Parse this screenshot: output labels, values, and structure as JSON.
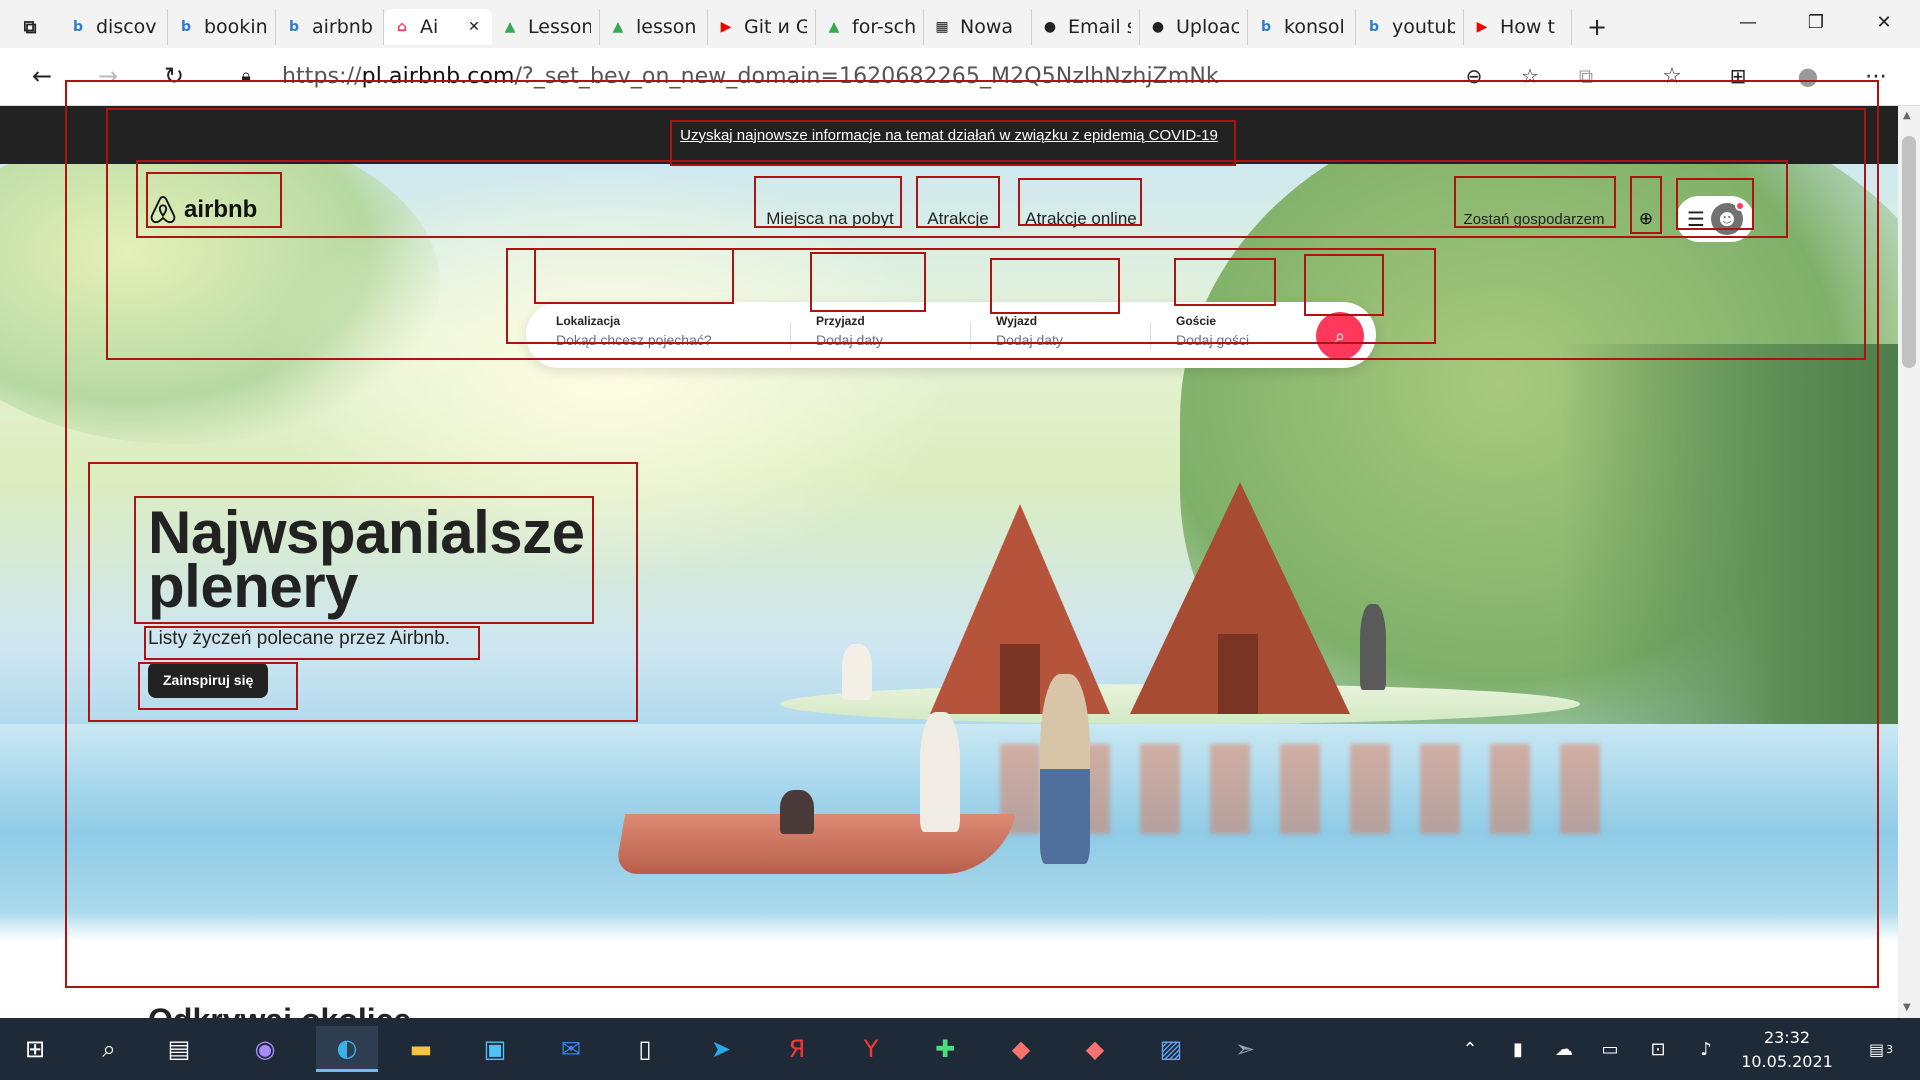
{
  "browser": {
    "tabs": [
      {
        "label": "discov",
        "icon": "bing-icon"
      },
      {
        "label": "bookin",
        "icon": "bing-icon"
      },
      {
        "label": "airbnb",
        "icon": "bing-icon"
      },
      {
        "label": "Ai",
        "icon": "airbnb-icon",
        "active": true
      },
      {
        "label": "Lesson",
        "icon": "google-drive-icon"
      },
      {
        "label": "lesson",
        "icon": "google-drive-icon"
      },
      {
        "label": "Git и G",
        "icon": "youtube-icon"
      },
      {
        "label": "for-sch",
        "icon": "google-drive-icon"
      },
      {
        "label": "Nowa",
        "icon": "new-tab-icon"
      },
      {
        "label": "Email s",
        "icon": "github-icon"
      },
      {
        "label": "Uploac",
        "icon": "github-icon"
      },
      {
        "label": "konsol",
        "icon": "bing-icon"
      },
      {
        "label": "youtub",
        "icon": "bing-icon"
      },
      {
        "label": "How t",
        "icon": "youtube-icon"
      }
    ],
    "url_prefix": "https://",
    "url_host": "pl.airbnb.com",
    "url_path": "/?_set_bev_on_new_domain=1620682265_M2Q5NzlhNzhjZmNk"
  },
  "page": {
    "covid_banner": "Uzyskaj najnowsze informacje na temat działań w związku z epidemią COVID-19",
    "logo_text": "airbnb",
    "nav_tabs": [
      "Miejsca na pobyt",
      "Atrakcje",
      "Atrakcje online"
    ],
    "host_link": "Zostań gospodarzem",
    "search": {
      "location_label": "Lokalizacja",
      "location_placeholder": "Dokąd chcesz pojechać?",
      "checkin_label": "Przyjazd",
      "checkin_placeholder": "Dodaj daty",
      "checkout_label": "Wyjazd",
      "checkout_placeholder": "Dodaj daty",
      "guests_label": "Goście",
      "guests_placeholder": "Dodaj gości"
    },
    "hero_title": "Najwspanialsze plenery",
    "hero_subtitle": "Listy życzeń polecane przez Airbnb.",
    "hero_button": "Zainspiruj się",
    "next_section_heading": "Odkrywaj okolice"
  },
  "taskbar": {
    "time": "23:32",
    "date": "10.05.2021",
    "notification_count": "3"
  },
  "colors": {
    "brand": "#ff385c",
    "banner_bg": "#222222",
    "taskbar_bg": "#1f2a38"
  }
}
